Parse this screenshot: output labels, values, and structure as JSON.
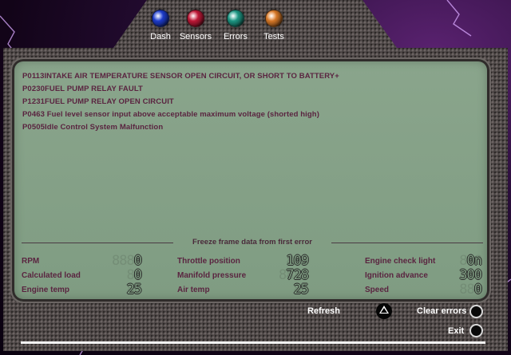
{
  "nav": {
    "items": [
      {
        "label": "Dash",
        "color": "#1f3fd6"
      },
      {
        "label": "Sensors",
        "color": "#c81a3a"
      },
      {
        "label": "Errors",
        "color": "#1f9e8a"
      },
      {
        "label": "Tests",
        "color": "#e27f2a"
      }
    ]
  },
  "errors": [
    "P0113INTAKE AIR TEMPERATURE SENSOR OPEN CIRCUIT, OR SHORT TO BATTERY+",
    "P0230FUEL PUMP RELAY FAULT",
    "P1231FUEL PUMP RELAY OPEN CIRCUIT",
    "P0463  Fuel level sensor input above acceptable maximum voltage (shorted high)",
    "P0505Idle Control System Malfunction"
  ],
  "freeze_frame": {
    "title": "Freeze frame data from first error",
    "metrics": [
      {
        "label": "RPM",
        "ghost": "8888",
        "value": "0"
      },
      {
        "label": "Calculated load",
        "ghost": "88",
        "value": "0"
      },
      {
        "label": "Engine temp",
        "ghost": "88",
        "value": "25"
      },
      {
        "label": "Throttle position",
        "ghost": "888",
        "value": "109"
      },
      {
        "label": "Manifold pressure",
        "ghost": "8888",
        "value": "728"
      },
      {
        "label": "Air temp",
        "ghost": "88",
        "value": "25"
      },
      {
        "label": "Engine check light",
        "ghost": "888",
        "value": "0n"
      },
      {
        "label": "Ignition advance",
        "ghost": "888",
        "value": "300"
      },
      {
        "label": "Speed",
        "ghost": "888",
        "value": "0"
      }
    ]
  },
  "controls": {
    "refresh": "Refresh",
    "clear_errors": "Clear errors",
    "exit": "Exit"
  }
}
